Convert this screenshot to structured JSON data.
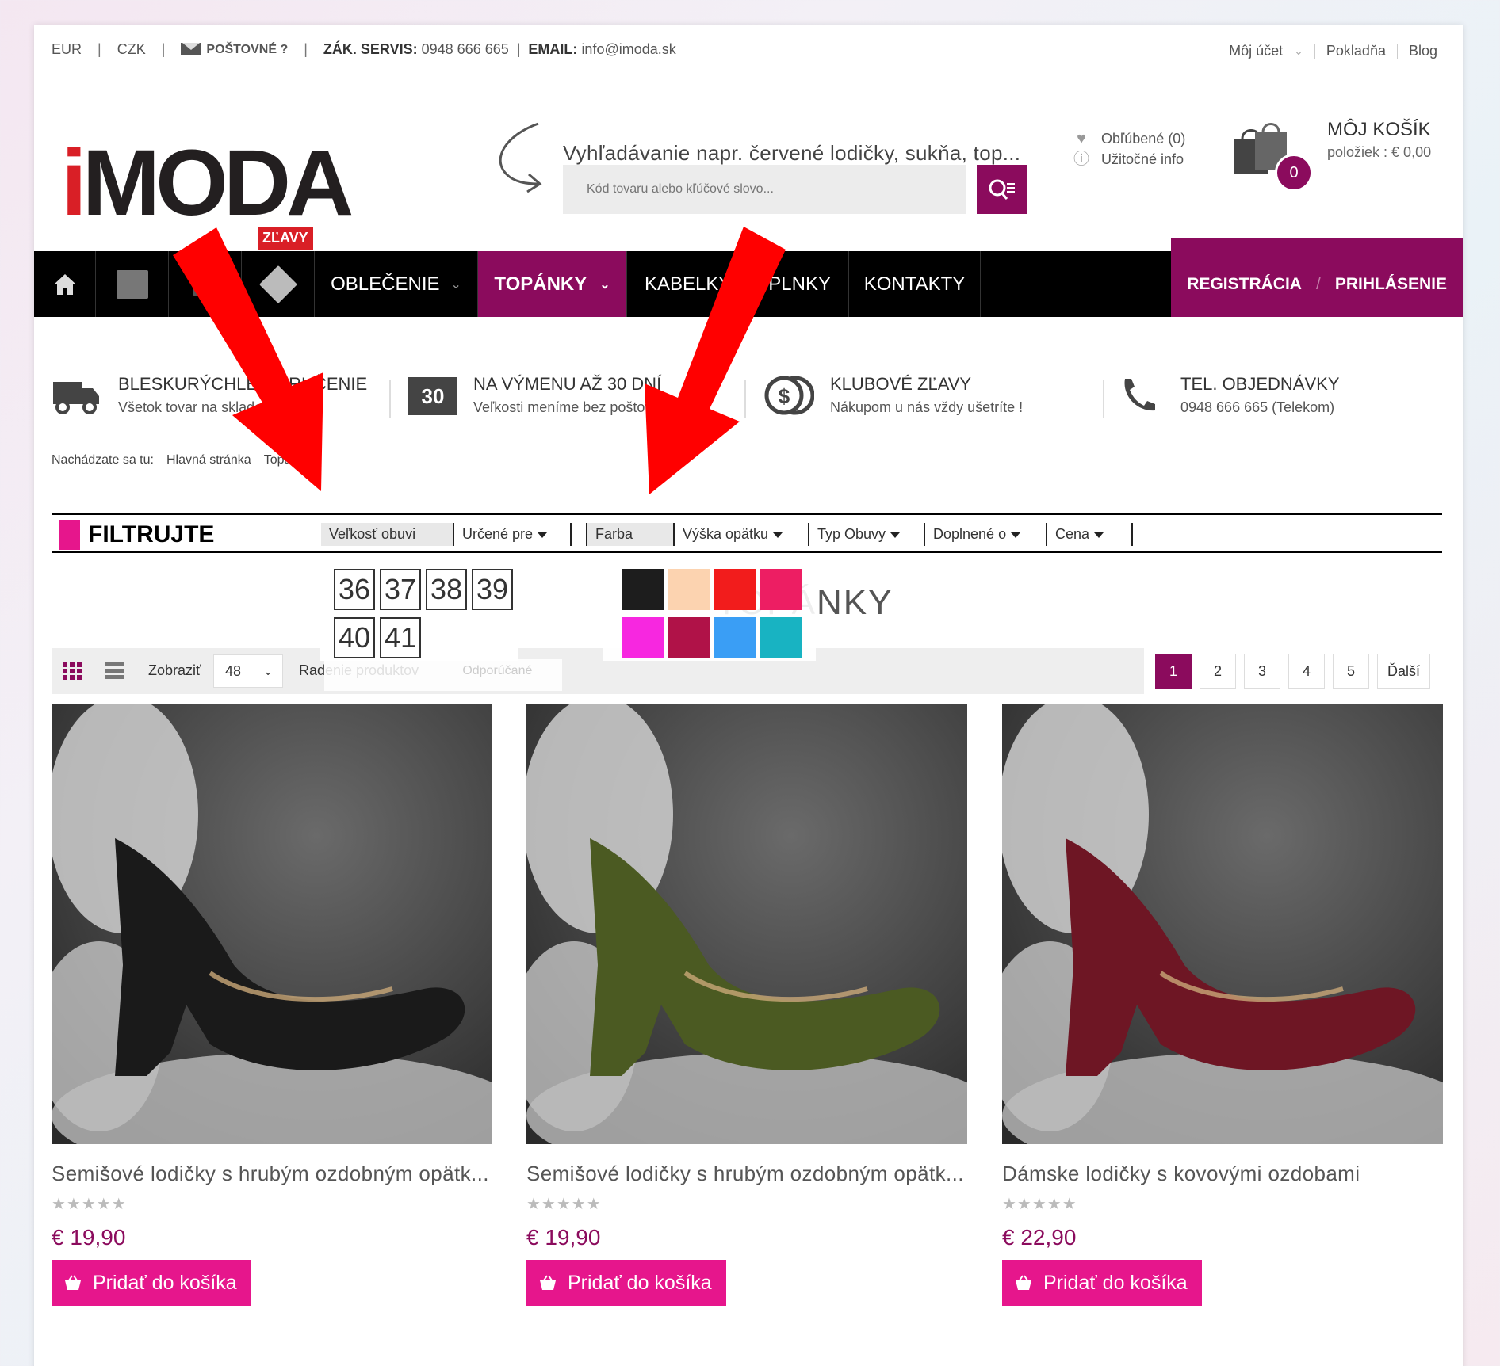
{
  "topbar": {
    "currency_eur": "EUR",
    "currency_czk": "CZK",
    "postovne": "POŠTOVNÉ ?",
    "servis_label": "ZÁK. SERVIS:",
    "servis_phone": "0948 666 665",
    "email_label": "EMAIL:",
    "email_value": "info@imoda.sk",
    "moj_ucet": "Môj účet",
    "pokladna": "Pokladňa",
    "blog": "Blog"
  },
  "header": {
    "logo_i": "i",
    "logo_rest": "MODA",
    "search_hint": "Vyhľadávanie napr. červené lodičky, sukňa, top...",
    "search_placeholder": "Kód tovaru alebo kľúčové slovo...",
    "favorites": "Obľúbené (0)",
    "useful_info": "Užitočné info",
    "cart_title": "MÔJ KOŠÍK",
    "cart_sub": "položiek : € 0,00",
    "cart_count": "0"
  },
  "nav": {
    "zlavy_badge": "ZĽAVY",
    "oblecenie": "OBLEČENIE",
    "topanky": "TOPÁNKY",
    "kabelky": "KABELKY",
    "doplnky": "DOPLNKY",
    "kontakty": "KONTAKTY",
    "registracia": "REGISTRÁCIA",
    "prihlasenie": "PRIHLÁSENIE"
  },
  "info": [
    {
      "title": "BLESKURÝCHLE DORUČENIE",
      "sub": "Všetok tovar na sklade"
    },
    {
      "title": "NA VÝMENU AŽ 30 DNÍ",
      "sub": "Veľkosti meníme bez poštovného"
    },
    {
      "title": "KLUBOVÉ ZĽAVY",
      "sub": "Nákupom u nás vždy ušetríte !"
    },
    {
      "title": "TEL. OBJEDNÁVKY",
      "sub": "0948 666 665 (Telekom)"
    }
  ],
  "info_badge_30": "30",
  "breadcrumb": {
    "label": "Nachádzate sa tu:",
    "home": "Hlavná stránka",
    "current": "Topánky"
  },
  "filter": {
    "label": "FILTRUJTE",
    "items": [
      "Veľkosť obuvi",
      "Určené pre",
      "Farba",
      "Výška opätku",
      "Typ Obuvy",
      "Doplnené o",
      "Cena"
    ],
    "sizes": [
      "36",
      "37",
      "38",
      "39",
      "40",
      "41"
    ],
    "colors": [
      "#1d1d1d",
      "#fcd3b0",
      "#f21c1c",
      "#ed1e63",
      "#f727e0",
      "#b01248",
      "#3a9ef5",
      "#18b3c2"
    ]
  },
  "page_title": "TOPÁNKY",
  "toolbar": {
    "zobrazit": "Zobraziť",
    "per_page": "48",
    "radenie": "Radenie produktov",
    "sort_value": "Odporúčané",
    "pages": [
      "1",
      "2",
      "3",
      "4",
      "5"
    ],
    "next": "Ďalší"
  },
  "products": [
    {
      "name": "Semišové lodičky s hrubým ozdobným opätk...",
      "price": "€ 19,90",
      "button": "Pridať do košíka",
      "color": "#1a1a1a",
      "rating": "★★★★★"
    },
    {
      "name": "Semišové lodičky s hrubým ozdobným opätk...",
      "price": "€ 19,90",
      "button": "Pridať do košíka",
      "color": "#4b5a22",
      "rating": "★★★★★"
    },
    {
      "name": "Dámske lodičky s kovovými ozdobami",
      "price": "€ 22,90",
      "button": "Pridať do košíka",
      "color": "#6e1624",
      "rating": "★★★★★"
    }
  ]
}
